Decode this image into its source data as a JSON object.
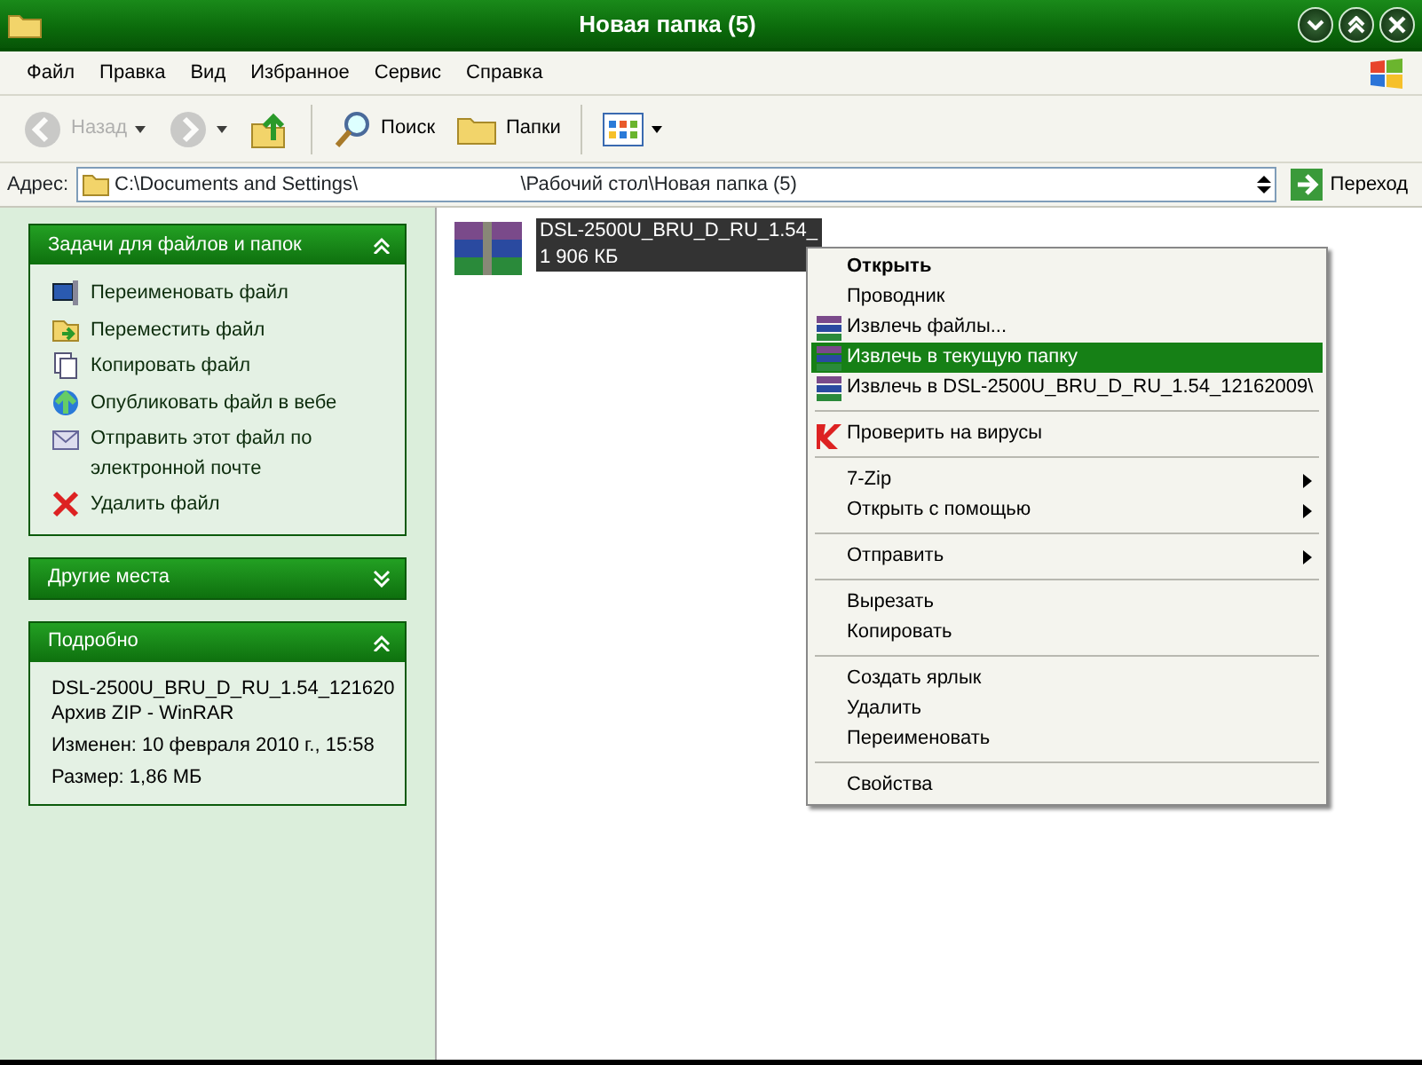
{
  "window": {
    "title": "Новая папка (5)"
  },
  "menu_bar": [
    "Файл",
    "Правка",
    "Вид",
    "Избранное",
    "Сервис",
    "Справка"
  ],
  "toolbar": [
    {
      "kind": "back",
      "label": "Назад",
      "disabled": true
    },
    {
      "kind": "forward",
      "disabled": true
    },
    {
      "kind": "up"
    },
    {
      "kind": "search",
      "label": "Поиск"
    },
    {
      "kind": "folders",
      "label": "Папки"
    },
    {
      "kind": "views"
    }
  ],
  "address_bar": {
    "label": "Адрес:",
    "value": "C:\\Documents and Settings\\                              \\Рабочий стол\\Новая папка (5)",
    "go_button": "Переход"
  },
  "sidebar": [
    {
      "kind": "tasks",
      "title": "Задачи для файлов и папок",
      "expanded": true,
      "items": [
        {
          "kind": "rename",
          "label": "Переименовать файл"
        },
        {
          "kind": "move",
          "label": "Переместить файл"
        },
        {
          "kind": "copy",
          "label": "Копировать файл"
        },
        {
          "kind": "publish",
          "label": "Опубликовать файл в вебе"
        },
        {
          "kind": "email",
          "label": "Отправить этот файл по электронной почте"
        },
        {
          "kind": "delete",
          "label": "Удалить файл"
        }
      ]
    },
    {
      "kind": "tasks",
      "title": "Другие места",
      "expanded": false
    },
    {
      "kind": "details",
      "title": "Подробно",
      "expanded": true,
      "lines": [
        "DSL-2500U_BRU_D_RU_1.54_121620",
        "Архив ZIP - WinRAR",
        "Изменен: 10 февраля 2010 г., 15:58",
        "Размер: 1,86 МБ"
      ]
    }
  ],
  "files": [
    {
      "name": "DSL-2500U_BRU_D_RU_1.54_",
      "size": "1 906 КБ",
      "selected": true
    }
  ],
  "context_menu": [
    {
      "kind": "default",
      "label": "Открыть",
      "selected": false
    },
    {
      "kind": "plain",
      "label": "Проводник",
      "selected": false
    },
    {
      "kind": "archive",
      "label": "Извлечь файлы...",
      "selected": false
    },
    {
      "kind": "archive",
      "label": "Извлечь в текущую папку",
      "selected": true
    },
    {
      "kind": "archive",
      "label": "Извлечь в DSL-2500U_BRU_D_RU_1.54_12162009\\",
      "selected": false
    },
    {
      "kind": "separator"
    },
    {
      "kind": "scan",
      "label": "Проверить на вирусы",
      "selected": false
    },
    {
      "kind": "separator"
    },
    {
      "kind": "submenu",
      "label": "7-Zip",
      "selected": false
    },
    {
      "kind": "submenu",
      "label": "Открыть с помощью",
      "selected": false
    },
    {
      "kind": "separator"
    },
    {
      "kind": "submenu",
      "label": "Отправить",
      "selected": false
    },
    {
      "kind": "separator"
    },
    {
      "kind": "plain",
      "label": "Вырезать",
      "selected": false
    },
    {
      "kind": "plain",
      "label": "Копировать",
      "selected": false
    },
    {
      "kind": "separator"
    },
    {
      "kind": "plain",
      "label": "Создать ярлык",
      "selected": false
    },
    {
      "kind": "plain",
      "label": "Удалить",
      "selected": false
    },
    {
      "kind": "plain",
      "label": "Переименовать",
      "selected": false
    },
    {
      "kind": "separator"
    },
    {
      "kind": "plain",
      "label": "Свойства",
      "selected": false
    }
  ]
}
